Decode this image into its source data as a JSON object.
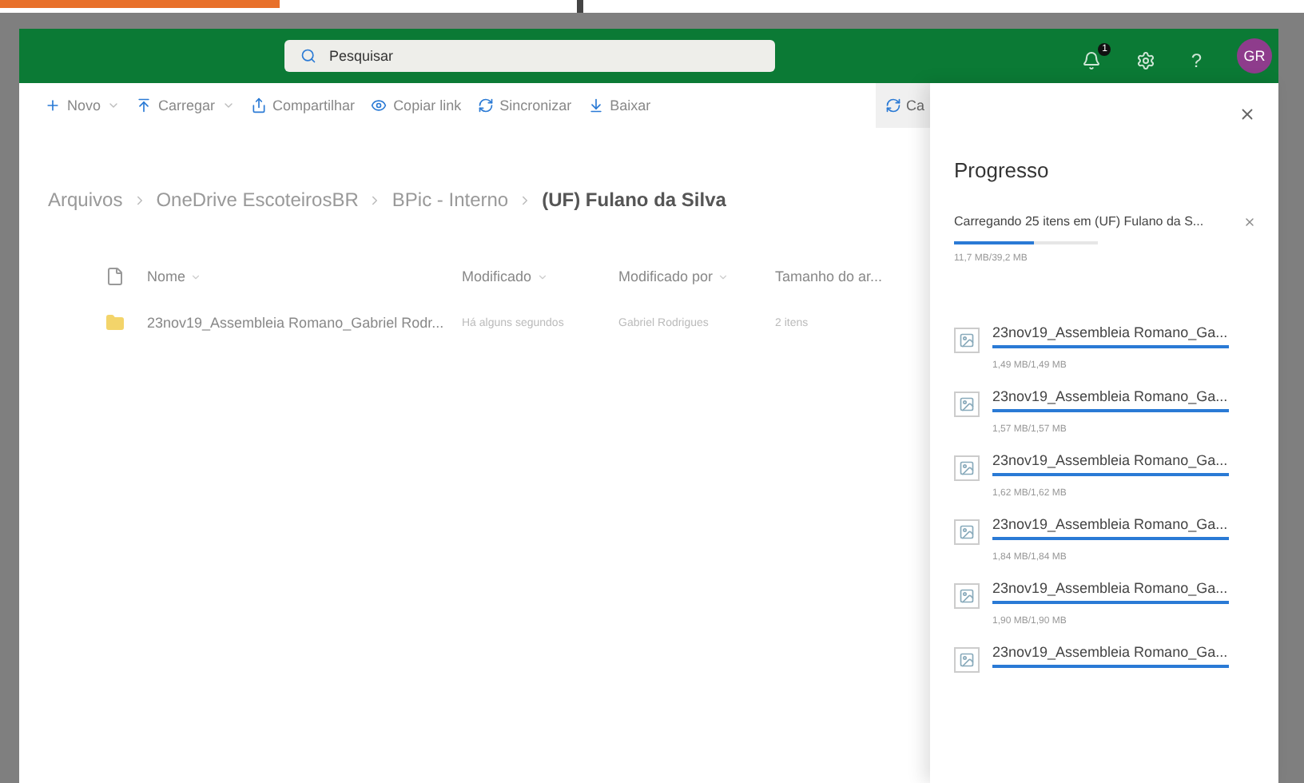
{
  "header": {
    "search": {
      "placeholder": "Pesquisar"
    },
    "notification_badge": "1",
    "help": "?",
    "avatar": "GR"
  },
  "toolbar": [
    {
      "label": "Novo",
      "dropdown": true
    },
    {
      "label": "Carregar",
      "dropdown": true
    },
    {
      "label": "Compartilhar",
      "dropdown": false
    },
    {
      "label": "Copiar link",
      "dropdown": false
    },
    {
      "label": "Sincronizar",
      "dropdown": false
    },
    {
      "label": "Baixar",
      "dropdown": false
    }
  ],
  "toolbar_cut_button": "Ca",
  "breadcrumb": [
    {
      "label": "Arquivos",
      "current": false
    },
    {
      "label": "OneDrive EscoteirosBR",
      "current": false
    },
    {
      "label": "BPic - Interno",
      "current": false
    },
    {
      "label": "(UF) Fulano da Silva",
      "current": true
    }
  ],
  "table": {
    "columns": [
      "Nome",
      "Modificado",
      "Modificado por",
      "Tamanho do ar..."
    ],
    "rows": [
      {
        "name": "23nov19_Assembleia Romano_Gabriel Rodr...",
        "modified": "Há alguns segundos",
        "modified_by": "Gabriel Rodrigues",
        "size": "2 itens"
      }
    ]
  },
  "panel": {
    "title": "Progresso",
    "upload": {
      "label": "Carregando 25 itens em (UF) Fulano da S...",
      "level": 0.55,
      "size": "11,7 MB/39,2 MB"
    },
    "items": [
      {
        "name": "23nov19_Assembleia Romano_Ga...",
        "level": 1,
        "size": "1,49 MB/1,49 MB"
      },
      {
        "name": "23nov19_Assembleia Romano_Ga...",
        "level": 1,
        "size": "1,57 MB/1,57 MB"
      },
      {
        "name": "23nov19_Assembleia Romano_Ga...",
        "level": 1,
        "size": "1,62 MB/1,62 MB"
      },
      {
        "name": "23nov19_Assembleia Romano_Ga...",
        "level": 1,
        "size": "1,84 MB/1,84 MB"
      },
      {
        "name": "23nov19_Assembleia Romano_Ga...",
        "level": 1,
        "size": "1,90 MB/1,90 MB"
      },
      {
        "name": "23nov19_Assembleia Romano_Ga...",
        "level": 1
      }
    ]
  }
}
